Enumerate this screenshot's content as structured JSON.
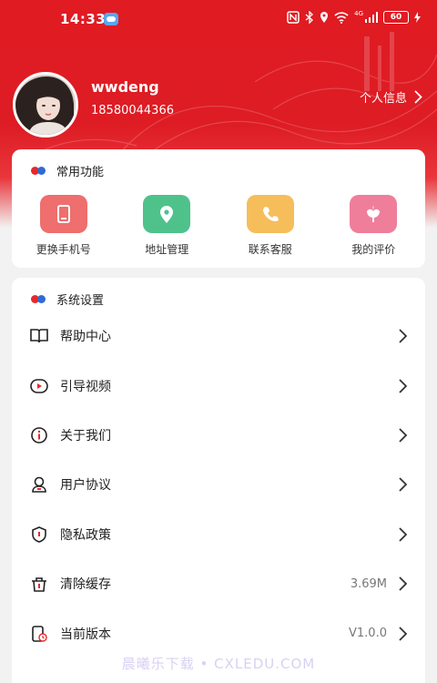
{
  "status_bar": {
    "time": "14:33",
    "network": "4G",
    "battery": "60",
    "icons": [
      "nfc-icon",
      "bluetooth-icon",
      "location-icon",
      "wifi-icon",
      "signal-icon",
      "battery-icon",
      "charging-icon"
    ]
  },
  "profile": {
    "username": "wwdeng",
    "phone": "18580044366",
    "info_link": "个人信息"
  },
  "common": {
    "title": "常用功能",
    "items": [
      {
        "label": "更换手机号",
        "icon": "phone-icon",
        "color": "#ef6e6e"
      },
      {
        "label": "地址管理",
        "icon": "location-pin-icon",
        "color": "#4fc28c"
      },
      {
        "label": "联系客服",
        "icon": "call-icon",
        "color": "#f6bd5b"
      },
      {
        "label": "我的评价",
        "icon": "flower-icon",
        "color": "#ef7e9b"
      }
    ]
  },
  "settings": {
    "title": "系统设置",
    "items": [
      {
        "label": "帮助中心",
        "icon": "book-icon",
        "value": ""
      },
      {
        "label": "引导视频",
        "icon": "video-icon",
        "value": ""
      },
      {
        "label": "关于我们",
        "icon": "info-icon",
        "value": ""
      },
      {
        "label": "用户协议",
        "icon": "user-agreement-icon",
        "value": ""
      },
      {
        "label": "隐私政策",
        "icon": "shield-icon",
        "value": ""
      },
      {
        "label": "清除缓存",
        "icon": "trash-icon",
        "value": "3.69M"
      },
      {
        "label": "当前版本",
        "icon": "version-icon",
        "value": "V1.0.0"
      }
    ]
  },
  "watermark": "晨曦乐下载 • CXLEDU.COM",
  "colors": {
    "brand_red": "#e01b22",
    "accent_red": "#e42a2a",
    "accent_blue": "#2f6bd6"
  }
}
